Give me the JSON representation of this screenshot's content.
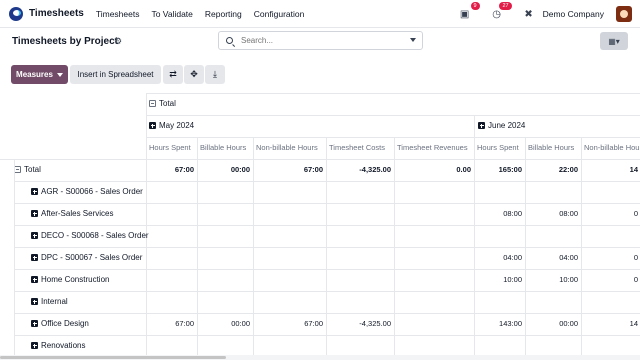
{
  "navbar": {
    "app_name": "Timesheets",
    "menu": [
      "Timesheets",
      "To Validate",
      "Reporting",
      "Configuration"
    ],
    "messages_count": "9",
    "activities_count": "27",
    "company": "Demo Company"
  },
  "control_panel": {
    "title": "Timesheets by Project",
    "search_placeholder": "Search..."
  },
  "toolbar": {
    "measures_label": "Measures",
    "spreadsheet_label": "Insert in Spreadsheet"
  },
  "pivot": {
    "col_total_label": "Total",
    "groups": [
      "May 2024",
      "June 2024"
    ],
    "measures": [
      "Hours Spent",
      "Billable Hours",
      "Non-billable Hours",
      "Timesheet Costs",
      "Timesheet Revenues",
      "Hours Spent",
      "Billable Hours",
      "Non-billable Hours"
    ],
    "row_total_label": "Total",
    "total_row": [
      "67:00",
      "00:00",
      "67:00",
      "-4,325.00",
      "0.00",
      "165:00",
      "22:00",
      "14"
    ],
    "rows": [
      {
        "label": "AGR - S00066 - Sales Order",
        "values": [
          "",
          "",
          "",
          "",
          "",
          "",
          "",
          ""
        ]
      },
      {
        "label": "After-Sales Services",
        "values": [
          "",
          "",
          "",
          "",
          "",
          "08:00",
          "08:00",
          "0"
        ]
      },
      {
        "label": "DECO - S00068 - Sales Order",
        "values": [
          "",
          "",
          "",
          "",
          "",
          "",
          "",
          ""
        ]
      },
      {
        "label": "DPC - S00067 - Sales Order",
        "values": [
          "",
          "",
          "",
          "",
          "",
          "04:00",
          "04:00",
          "0"
        ]
      },
      {
        "label": "Home Construction",
        "values": [
          "",
          "",
          "",
          "",
          "",
          "10:00",
          "10:00",
          "0"
        ]
      },
      {
        "label": "Internal",
        "values": [
          "",
          "",
          "",
          "",
          "",
          "",
          "",
          ""
        ]
      },
      {
        "label": "Office Design",
        "values": [
          "67:00",
          "00:00",
          "67:00",
          "-4,325.00",
          "",
          "143:00",
          "00:00",
          "14"
        ]
      },
      {
        "label": "Renovations",
        "values": [
          "",
          "",
          "",
          "",
          "",
          "",
          "",
          ""
        ]
      }
    ]
  },
  "colors": {
    "primary": "#714b67",
    "badge": "#e11d48",
    "logo": "#1f3a8a"
  }
}
